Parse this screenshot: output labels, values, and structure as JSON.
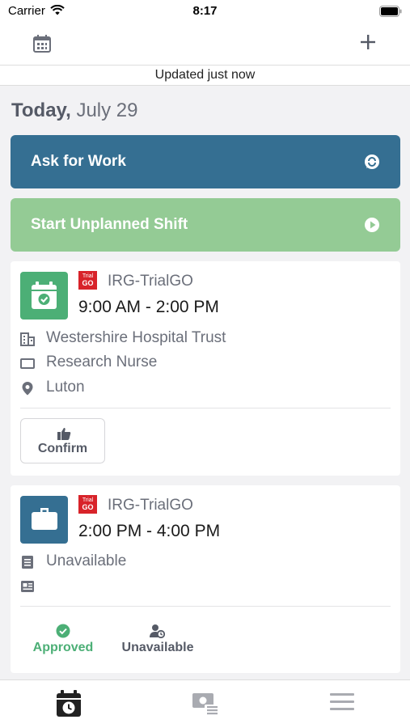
{
  "status_bar": {
    "carrier": "Carrier",
    "time": "8:17"
  },
  "nav": {
    "left_icon": "calendar-icon",
    "right_icon": "plus-icon"
  },
  "update_status": "Updated just now",
  "date_header": {
    "day": "Today,",
    "date": "July 29"
  },
  "actions": {
    "ask_for_work": {
      "label": "Ask for Work",
      "icon": "chat-icon",
      "color": "#356f92"
    },
    "start_unplanned": {
      "label": "Start Unplanned Shift",
      "icon": "play-icon",
      "color": "#94cb95"
    }
  },
  "shifts": [
    {
      "icon": "calendar-check-icon",
      "icon_color": "#4caf76",
      "org_logo_text": "Trial",
      "org_logo_mark": "GO",
      "org": "IRG-TrialGO",
      "time": "9:00 AM - 2:00 PM",
      "details": [
        {
          "icon": "building-icon",
          "text": "Westershire Hospital Trust"
        },
        {
          "icon": "badge-icon",
          "text": "Research Nurse"
        },
        {
          "icon": "location-pin-icon",
          "text": "Luton"
        }
      ],
      "action_label": "Confirm"
    },
    {
      "icon": "briefcase-icon",
      "icon_color": "#356f92",
      "org_logo_text": "Trial",
      "org_logo_mark": "GO",
      "org": "IRG-TrialGO",
      "time": "2:00 PM - 4:00 PM",
      "details": [
        {
          "icon": "document-icon",
          "text": "Unavailable"
        },
        {
          "icon": "newspaper-icon",
          "text": ""
        }
      ],
      "statuses": [
        {
          "label": "Approved",
          "icon": "check-circle-icon",
          "color": "#4caf76"
        },
        {
          "label": "Unavailable",
          "icon": "user-clock-icon",
          "color": "#555a66"
        }
      ]
    }
  ],
  "tabs": [
    {
      "name": "schedule",
      "icon": "calendar-clock-icon",
      "active": true
    },
    {
      "name": "timesheets",
      "icon": "money-list-icon",
      "active": false
    },
    {
      "name": "menu",
      "icon": "hamburger-icon",
      "active": false
    }
  ]
}
